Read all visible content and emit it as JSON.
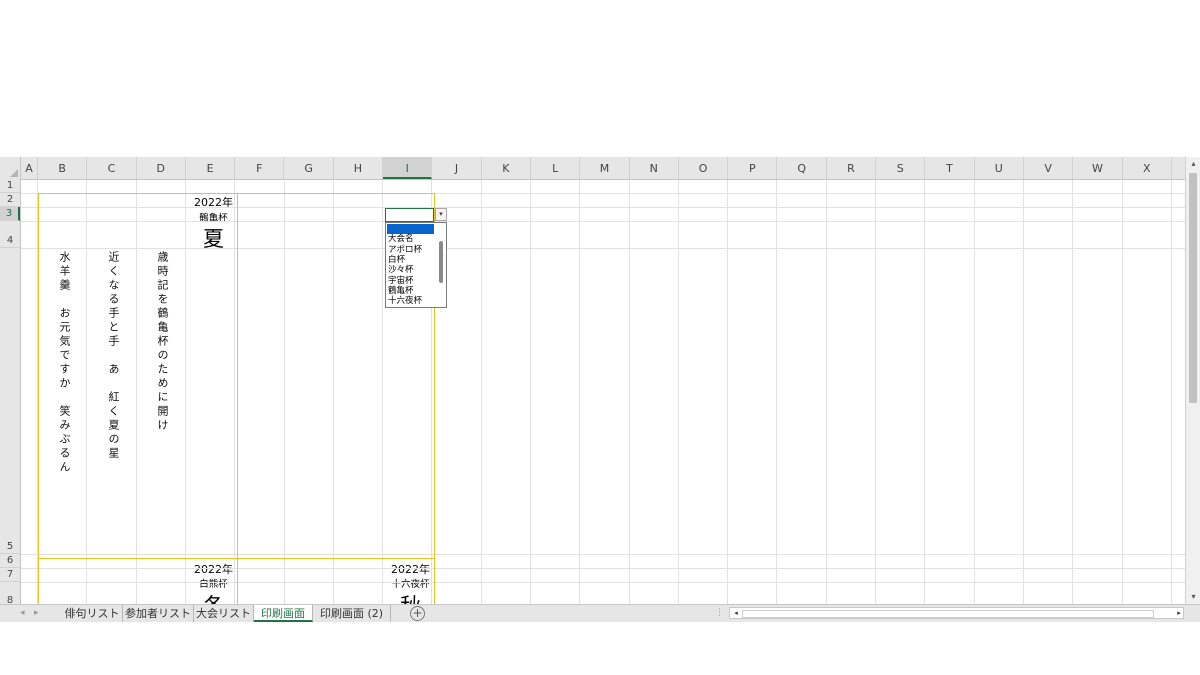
{
  "columns": [
    "A",
    "B",
    "C",
    "D",
    "E",
    "F",
    "G",
    "H",
    "I",
    "J",
    "K",
    "L",
    "M",
    "N",
    "O",
    "P",
    "Q",
    "R",
    "S",
    "T",
    "U",
    "V",
    "W",
    "X"
  ],
  "selected_column": "I",
  "rows": [
    "1",
    "2",
    "3",
    "4",
    "5",
    "6",
    "7",
    "8"
  ],
  "selected_row": "3",
  "cells": {
    "e2_year": "2022年",
    "e3_tournament": "鶴亀杯",
    "e4_season": "夏",
    "b5_haiku": "水羊羹　お元気ですか　笑みぶるん",
    "c5_haiku": "近くなる手と手　あ　紅く夏の星",
    "d5_haiku": "歳時記を鶴亀杯のために開け",
    "e6_year": "2022年",
    "e7_tournament": "白熊杯",
    "e8_season": "冬",
    "i6_year": "2022年",
    "i7_tournament": "十六夜杯",
    "i8_season": "秋"
  },
  "dropdown": {
    "current_value": "",
    "arrow_glyph": "▾",
    "options": [
      "",
      "大会名",
      "アポロ杯",
      "白杯",
      "沙々杯",
      "宇宙杯",
      "鶴亀杯",
      "十六夜杯"
    ],
    "highlighted_index": 0
  },
  "sheet_tabs": [
    "俳句リスト",
    "参加者リスト",
    "大会リスト",
    "印刷画面",
    "印刷画面 (2)"
  ],
  "active_tab": "印刷画面",
  "tab_nav": {
    "prev": "◂",
    "next": "▸",
    "add": "+",
    "more": "⋮"
  },
  "scroll": {
    "up": "▴",
    "down": "▾",
    "left": "◂",
    "right": "▸"
  },
  "colors": {
    "accent": "#217346",
    "print_area": "#f0c020",
    "dropdown_highlight": "#0a64cd"
  }
}
